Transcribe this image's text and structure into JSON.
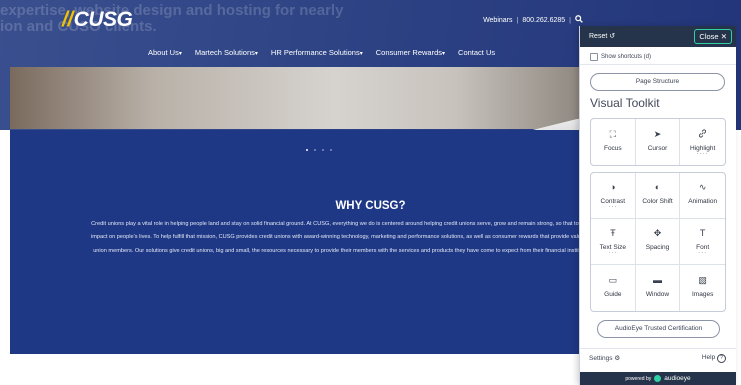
{
  "site": {
    "headline_lines": [
      "expertise, website design and hosting for nearly",
      "ion and CUSO clients."
    ],
    "logo": "CUSG",
    "utility": {
      "webinars": "Webinars",
      "phone": "800.262.6285",
      "search_icon": "search-icon"
    },
    "nav": [
      {
        "label": "About Us",
        "caret": "▾"
      },
      {
        "label": "Martech Solutions",
        "caret": "▾"
      },
      {
        "label": "HR Performance Solutions",
        "caret": "▾"
      },
      {
        "label": "Consumer Rewards",
        "caret": "▾"
      },
      {
        "label": "Contact Us",
        "caret": ""
      }
    ],
    "carousel_dots": 4,
    "why_title": "WHY CUSG?",
    "why_body": "Credit unions play a vital role in helping people land and stay on solid financial ground. At CUSG, everything we do is centered around helping credit unions serve, grow and remain strong, so that together we can make an impact on people’s lives. To help fulfill that mission, CUSG provides credit unions with award-winning technology, marketing and performance solutions, as well as consumer rewards that provide value and savings to credit union members. Our solutions give credit unions, big and small, the resources necessary to provide their members with the services and products they have come to expect from their financial institution in the digital age."
  },
  "toolkit": {
    "reset_label": "Reset",
    "reset_icon": "↺",
    "close_label": "Close",
    "close_icon": "✕",
    "shortcuts_label": "Show shortcuts (d)",
    "page_structure_label": "Page Structure",
    "title": "Visual Toolkit",
    "row1": [
      {
        "name": "focus",
        "label": "Focus",
        "icon": "⛶",
        "level": ""
      },
      {
        "name": "cursor",
        "label": "Cursor",
        "icon": "➤",
        "level": ""
      },
      {
        "name": "highlight",
        "label": "Highlight",
        "icon": "🔗",
        "level": "····"
      }
    ],
    "tiles": [
      {
        "name": "contrast",
        "label": "Contrast",
        "icon": "◑",
        "level": "···"
      },
      {
        "name": "color-shift",
        "label": "Color Shift",
        "icon": "◐",
        "level": ""
      },
      {
        "name": "animation",
        "label": "Animation",
        "icon": "∿",
        "level": ""
      },
      {
        "name": "text-size",
        "label": "Text Size",
        "icon": "Ŧ",
        "level": "···"
      },
      {
        "name": "spacing",
        "label": "Spacing",
        "icon": "✥",
        "level": ""
      },
      {
        "name": "font",
        "label": "Font",
        "icon": "T",
        "level": "···"
      },
      {
        "name": "guide",
        "label": "Guide",
        "icon": "▭",
        "level": ""
      },
      {
        "name": "window",
        "label": "Window",
        "icon": "▬",
        "level": ""
      },
      {
        "name": "images",
        "label": "Images",
        "icon": "▧",
        "level": ""
      }
    ],
    "certification_label": "AudioEye Trusted Certification",
    "settings_label": "Settings",
    "settings_icon": "⚙",
    "help_label": "Help",
    "help_icon": "?",
    "powered_label": "powered by",
    "brand": "audioeye"
  },
  "colors": {
    "band": "#1f3885",
    "panel_header": "#25344a",
    "accent": "#2fd1a4",
    "logo_mark": "#f2c200"
  }
}
